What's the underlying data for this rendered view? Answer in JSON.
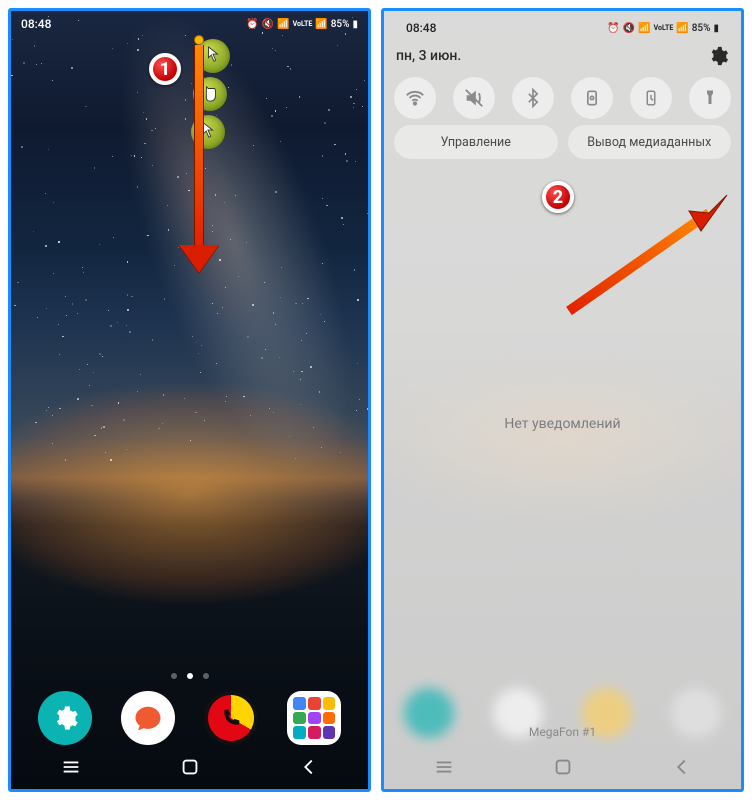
{
  "left": {
    "status": {
      "time": "08:48",
      "battery": "85%",
      "volte": "VoLTE"
    },
    "dock": {
      "settings": "settings",
      "messages": "messages",
      "phone": "phone",
      "apps": "apps"
    },
    "annotation": {
      "badge": "1"
    }
  },
  "right": {
    "status": {
      "time": "08:48",
      "battery": "85%",
      "volte": "VoLTE"
    },
    "date": "пн, 3 июн.",
    "qs": {
      "wifi": "wifi",
      "sound": "sound",
      "bluetooth": "bluetooth",
      "rotation": "rotation",
      "power": "power",
      "flashlight": "flashlight"
    },
    "panel": {
      "control": "Управление",
      "media": "Вывод медиаданных"
    },
    "no_notifications": "Нет уведомлений",
    "sim": "MegaFon #1",
    "annotation": {
      "badge": "2"
    }
  }
}
